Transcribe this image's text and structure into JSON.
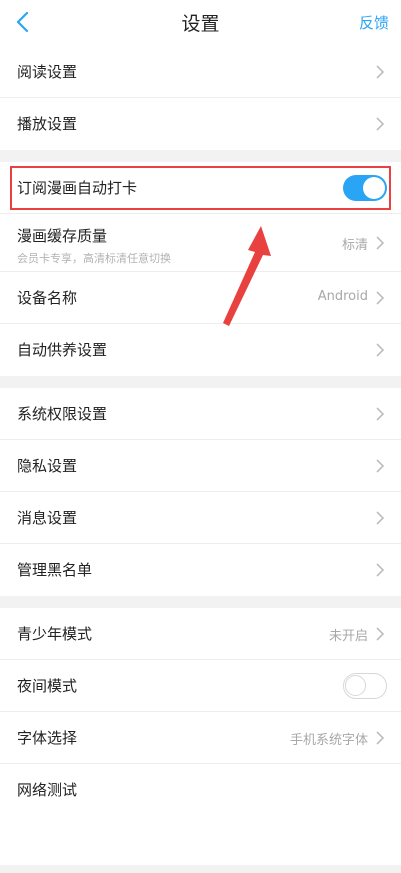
{
  "header": {
    "title": "设置",
    "feedback_label": "反馈",
    "back_icon": "chevron-left-icon"
  },
  "colors": {
    "accent": "#2aa4f4",
    "highlight": "#e8413f",
    "section_gap": "#f2f2f2"
  },
  "section1": {
    "reading": "阅读设置",
    "playback": "播放设置"
  },
  "section2": {
    "subscribe_checkin": {
      "label": "订阅漫画自动打卡",
      "enabled": true
    },
    "cache_quality": {
      "label": "漫画缓存质量",
      "sub": "会员卡专享，高清标清任意切换",
      "value": "标清"
    },
    "device_name": {
      "label": "设备名称",
      "value": "Android"
    },
    "auto_feed": "自动供养设置"
  },
  "section3": {
    "permissions": "系统权限设置",
    "privacy": "隐私设置",
    "messages": "消息设置",
    "blacklist": "管理黑名单"
  },
  "section4": {
    "teen_mode": {
      "label": "青少年模式",
      "value": "未开启"
    },
    "night_mode": {
      "label": "夜间模式",
      "enabled": false
    },
    "font": {
      "label": "字体选择",
      "value": "手机系统字体"
    },
    "network": "网络测试"
  }
}
